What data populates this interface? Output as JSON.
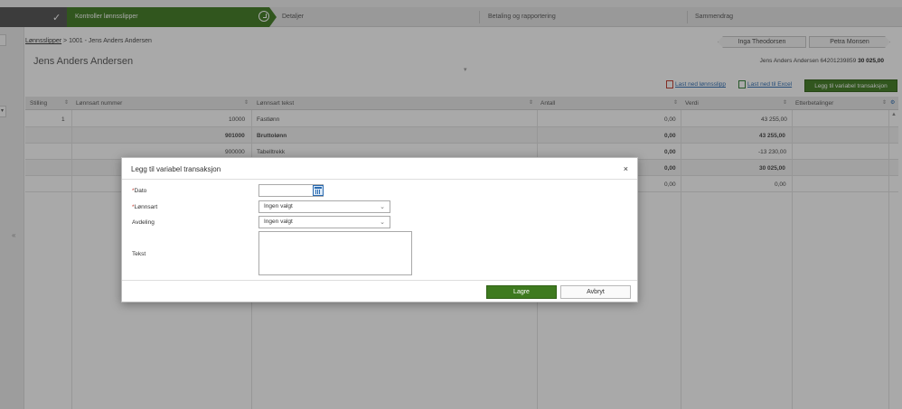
{
  "wizard": {
    "steps": [
      {
        "label": "Kontroller lønnsslipper",
        "state": "active"
      },
      {
        "label": "Detaljer",
        "state": "pending"
      },
      {
        "label": "Betaling og rapportering",
        "state": "pending"
      },
      {
        "label": "Sammendrag",
        "state": "pending"
      }
    ],
    "done_icon": "check-icon",
    "active_icon": "timer-icon"
  },
  "breadcrumb": {
    "root": "Lønnsslipper",
    "separator": ">",
    "current": "1001 - Jens Anders Andersen"
  },
  "page_title": "Jens Anders Andersen",
  "employee_nav": {
    "prev": "Inga Theodorsen",
    "next": "Petra Monsen"
  },
  "employee_info": {
    "name_id": "Jens Anders Andersen 64201239859",
    "amount": "30 025,00"
  },
  "actions": {
    "download_payslip": "Last ned lønnsslipp",
    "download_excel": "Last ned til Excel",
    "add_transaction": "Legg til variabel transaksjon"
  },
  "table": {
    "columns": [
      "Stilling",
      "Lønnsart nummer",
      "Lønnsart tekst",
      "Antall",
      "Verdi",
      "Etterbetalinger"
    ],
    "rows": [
      {
        "stilling": "1",
        "nummer": "10000",
        "tekst": "Fastlønn",
        "antall": "0,00",
        "verdi": "43 255,00",
        "bold": false
      },
      {
        "stilling": "",
        "nummer": "901000",
        "tekst": "Bruttolønn",
        "antall": "0,00",
        "verdi": "43 255,00",
        "bold": true
      },
      {
        "stilling": "",
        "nummer": "900000",
        "tekst": "Tabelltrekk",
        "antall": "0,00",
        "verdi": "-13 230,00",
        "bold": false
      },
      {
        "stilling": "",
        "nummer": "",
        "tekst": "",
        "antall": "0,00",
        "verdi": "30 025,00",
        "bold": true
      },
      {
        "stilling": "",
        "nummer": "",
        "tekst": "",
        "antall": "0,00",
        "verdi": "0,00",
        "bold": false
      }
    ]
  },
  "modal": {
    "title": "Legg til variabel transaksjon",
    "close": "×",
    "fields": {
      "dato": {
        "label": "Dato",
        "value": ""
      },
      "lonnsart": {
        "label": "Lønnsart",
        "value": "Ingen valgt"
      },
      "avdeling": {
        "label": "Avdeling",
        "value": "Ingen valgt"
      },
      "tekst": {
        "label": "Tekst",
        "value": ""
      }
    },
    "required_marker": "*",
    "save": "Lagre",
    "cancel": "Avbryt"
  }
}
